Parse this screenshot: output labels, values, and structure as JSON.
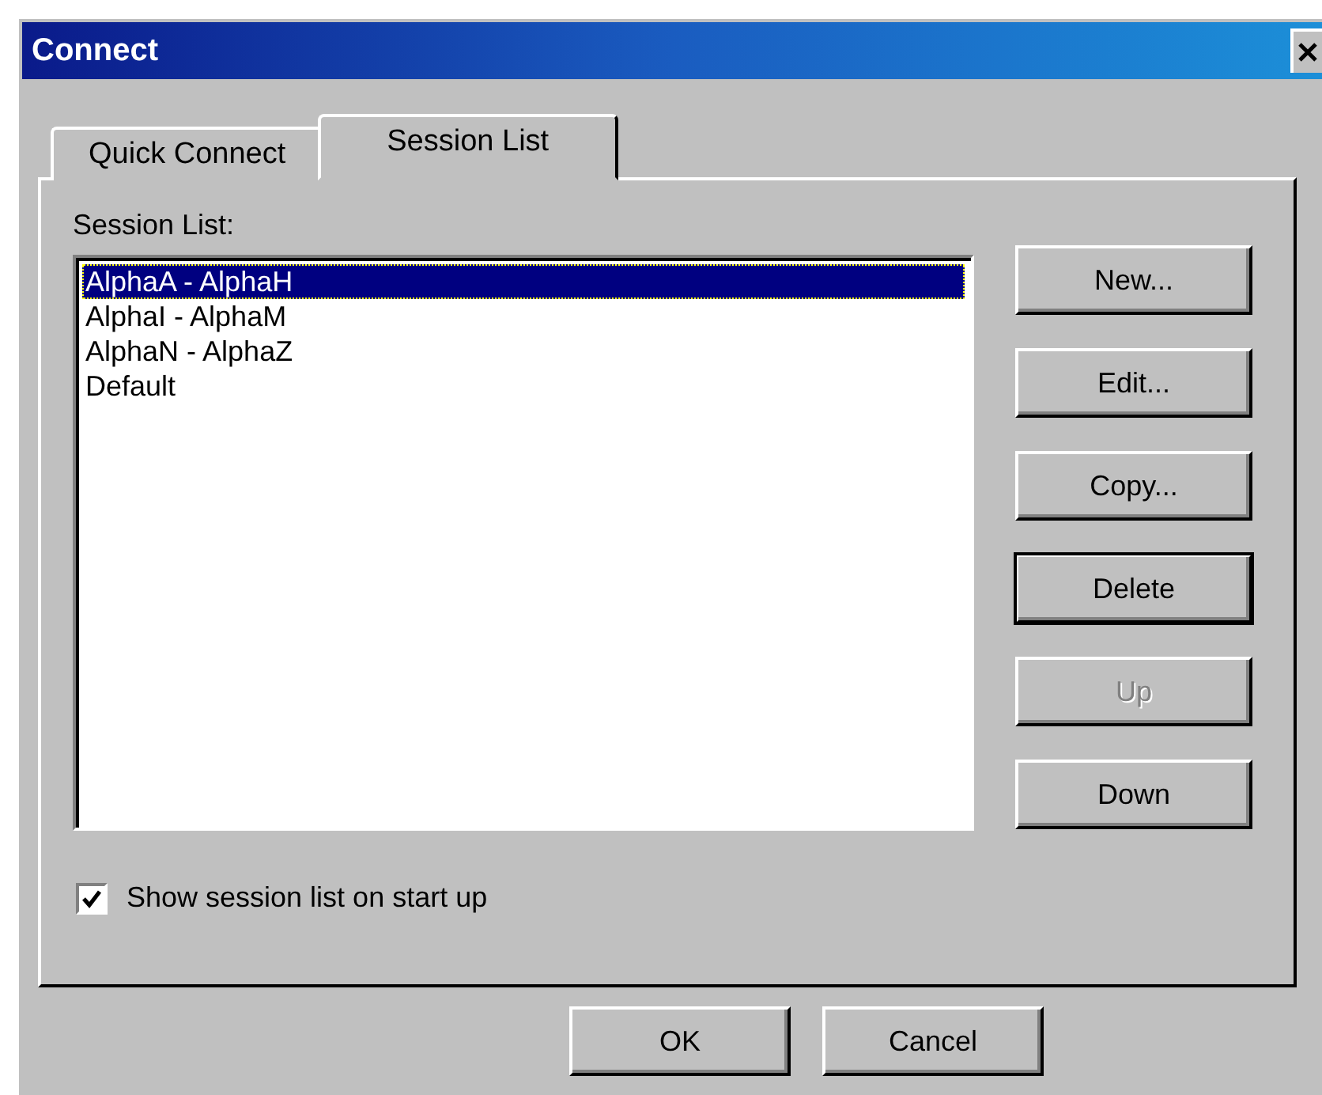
{
  "window": {
    "title": "Connect"
  },
  "tabs": [
    {
      "label": "Quick Connect",
      "selected": false
    },
    {
      "label": "Session List",
      "selected": true
    }
  ],
  "session_list": {
    "label": "Session List:",
    "items": [
      {
        "label": "AlphaA - AlphaH",
        "selected": true
      },
      {
        "label": "AlphaI - AlphaM",
        "selected": false
      },
      {
        "label": "AlphaN - AlphaZ",
        "selected": false
      },
      {
        "label": "Default",
        "selected": false
      }
    ]
  },
  "side_buttons": [
    {
      "label": "New...",
      "disabled": false,
      "default": false
    },
    {
      "label": "Edit...",
      "disabled": false,
      "default": false
    },
    {
      "label": "Copy...",
      "disabled": false,
      "default": false
    },
    {
      "label": "Delete",
      "disabled": false,
      "default": true
    },
    {
      "label": "Up",
      "disabled": true,
      "default": false
    },
    {
      "label": "Down",
      "disabled": false,
      "default": false
    }
  ],
  "show_on_startup": {
    "label": "Show session list on start up",
    "checked": true
  },
  "buttons": [
    "OK",
    "Cancel"
  ]
}
